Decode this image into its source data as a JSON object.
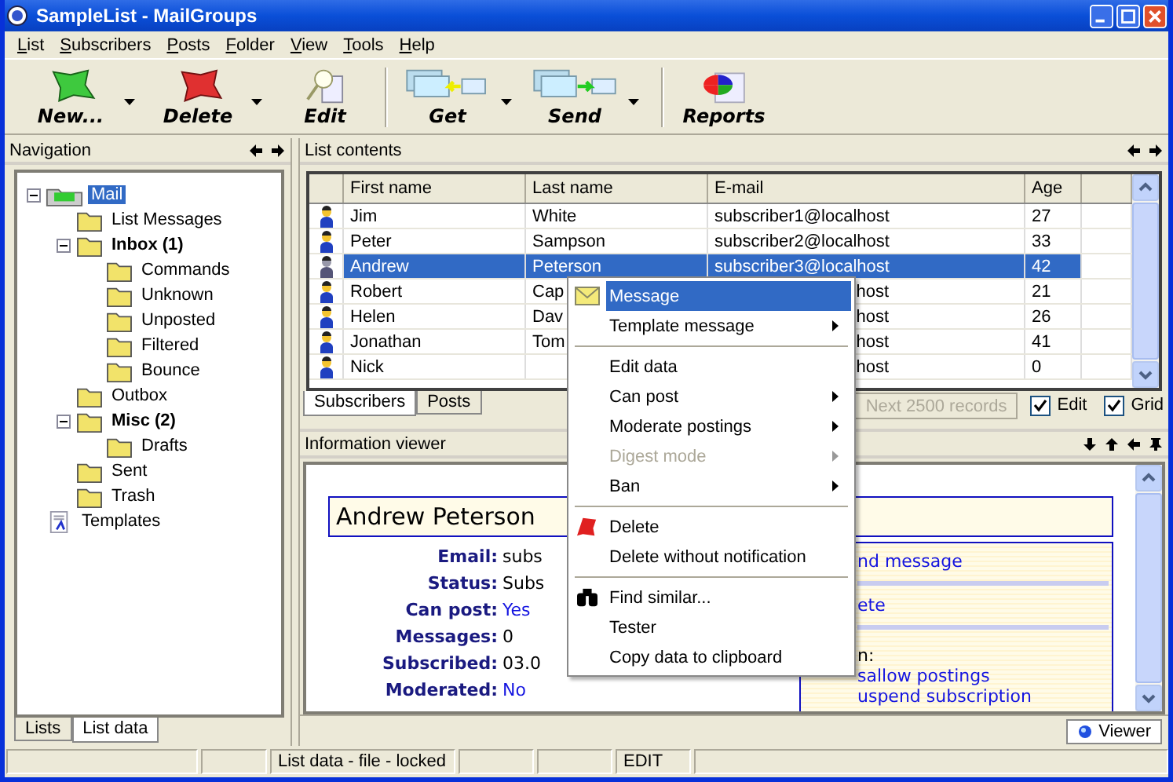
{
  "window": {
    "title": "SampleList - MailGroups"
  },
  "menu": [
    "List",
    "Subscribers",
    "Posts",
    "Folder",
    "View",
    "Tools",
    "Help"
  ],
  "toolbar": [
    {
      "label": "New...",
      "kind": "new",
      "dropdown": true
    },
    {
      "label": "Delete",
      "kind": "delete",
      "dropdown": true
    },
    {
      "label": "Edit",
      "kind": "edit",
      "dropdown": false
    },
    {
      "label": "Get",
      "kind": "get",
      "dropdown": true
    },
    {
      "label": "Send",
      "kind": "send",
      "dropdown": true
    },
    {
      "label": "Reports",
      "kind": "reports",
      "dropdown": false
    }
  ],
  "navigation": {
    "title": "Navigation",
    "tree": [
      {
        "label": "Mail",
        "kind": "mail",
        "bold": false,
        "selected": true,
        "expanded": true,
        "children": [
          {
            "label": "List Messages",
            "kind": "folder",
            "bold": false,
            "selected": false
          },
          {
            "label": "Inbox (1)",
            "kind": "folder",
            "bold": true,
            "selected": false,
            "expanded": true,
            "children": [
              {
                "label": "Commands",
                "kind": "folder",
                "bold": false,
                "selected": false
              },
              {
                "label": "Unknown",
                "kind": "folder",
                "bold": false,
                "selected": false
              },
              {
                "label": "Unposted",
                "kind": "folder",
                "bold": false,
                "selected": false
              },
              {
                "label": "Filtered",
                "kind": "folder",
                "bold": false,
                "selected": false
              },
              {
                "label": "Bounce",
                "kind": "folder",
                "bold": false,
                "selected": false
              }
            ]
          },
          {
            "label": "Outbox",
            "kind": "folder",
            "bold": false,
            "selected": false
          },
          {
            "label": "Misc (2)",
            "kind": "folder",
            "bold": true,
            "selected": false,
            "expanded": true,
            "children": [
              {
                "label": "Drafts",
                "kind": "folder",
                "bold": false,
                "selected": false
              }
            ]
          },
          {
            "label": "Sent",
            "kind": "folder",
            "bold": false,
            "selected": false
          },
          {
            "label": "Trash",
            "kind": "folder",
            "bold": false,
            "selected": false
          }
        ]
      },
      {
        "label": "Templates",
        "kind": "template",
        "bold": false,
        "selected": false
      }
    ],
    "tabs": [
      {
        "label": "Lists",
        "selected": false
      },
      {
        "label": "List data",
        "selected": true
      }
    ]
  },
  "list_contents": {
    "title": "List contents",
    "columns": [
      "First name",
      "Last name",
      "E-mail",
      "Age"
    ],
    "rows": [
      {
        "first_name": "Jim",
        "last_name": "White",
        "email": "subscriber1@localhost",
        "age": "27",
        "selected": false
      },
      {
        "first_name": "Peter",
        "last_name": "Sampson",
        "email": "subscriber2@localhost",
        "age": "33",
        "selected": false
      },
      {
        "first_name": "Andrew",
        "last_name": "Peterson",
        "email": "subscriber3@localhost",
        "age": "42",
        "selected": true
      },
      {
        "first_name": "Robert",
        "last_name": "Cap",
        "email": "host",
        "age": "21",
        "selected": false
      },
      {
        "first_name": "Helen",
        "last_name": "Dav",
        "email": "host",
        "age": "26",
        "selected": false
      },
      {
        "first_name": "Jonathan",
        "last_name": "Tom",
        "email": "host",
        "age": "41",
        "selected": false
      },
      {
        "first_name": "Nick",
        "email": "host",
        "age": "0",
        "selected": false
      }
    ],
    "tabs": [
      {
        "label": "Subscribers",
        "selected": true
      },
      {
        "label": "Posts",
        "selected": false
      }
    ],
    "next_button": {
      "label": "Next 2500 records",
      "disabled": true
    },
    "checkboxes": [
      {
        "label": "Edit",
        "checked": true
      },
      {
        "label": "Grid",
        "checked": true
      }
    ]
  },
  "information_viewer": {
    "title": "Information viewer",
    "name": "Andrew Peterson",
    "fields": [
      {
        "label": "Email:",
        "value": "subs",
        "link": false
      },
      {
        "label": "Status:",
        "value": "Subs",
        "link": false
      },
      {
        "label": "Can post:",
        "value": "Yes",
        "link": true
      },
      {
        "label": "Messages:",
        "value": "0",
        "link": false
      },
      {
        "label": "Subscribed:",
        "value": "03.0",
        "link": false
      },
      {
        "label": "Moderated:",
        "value": "No",
        "link": true
      }
    ],
    "actions": [
      "nd message",
      "ete"
    ],
    "section_label": "n:",
    "section_links": [
      "sallow postings",
      "uspend subscription"
    ],
    "viewer_button": "Viewer"
  },
  "context_menu": [
    {
      "kind": "message",
      "label": "Message",
      "selected": true,
      "disabled": false,
      "submenu": false
    },
    {
      "kind": "item",
      "label": "Template message",
      "selected": false,
      "disabled": false,
      "submenu": true
    },
    {
      "kind": "separator"
    },
    {
      "kind": "item",
      "label": "Edit data",
      "selected": false,
      "disabled": false,
      "submenu": false
    },
    {
      "kind": "item",
      "label": "Can post",
      "selected": false,
      "disabled": false,
      "submenu": true
    },
    {
      "kind": "item",
      "label": "Moderate postings",
      "selected": false,
      "disabled": false,
      "submenu": true
    },
    {
      "kind": "item",
      "label": "Digest mode",
      "selected": false,
      "disabled": true,
      "submenu": true
    },
    {
      "kind": "item",
      "label": "Ban",
      "selected": false,
      "disabled": false,
      "submenu": true
    },
    {
      "kind": "separator"
    },
    {
      "kind": "delete",
      "label": "Delete",
      "selected": false,
      "disabled": false,
      "submenu": false
    },
    {
      "kind": "item",
      "label": "Delete without notification",
      "selected": false,
      "disabled": false,
      "submenu": false
    },
    {
      "kind": "separator"
    },
    {
      "kind": "find",
      "label": "Find similar...",
      "selected": false,
      "disabled": false,
      "submenu": false
    },
    {
      "kind": "item",
      "label": "Tester",
      "selected": false,
      "disabled": false,
      "submenu": false
    },
    {
      "kind": "item",
      "label": "Copy data to clipboard",
      "selected": false,
      "disabled": false,
      "submenu": false
    }
  ],
  "status_bar": [
    "List data - file - locked",
    "EDIT"
  ]
}
